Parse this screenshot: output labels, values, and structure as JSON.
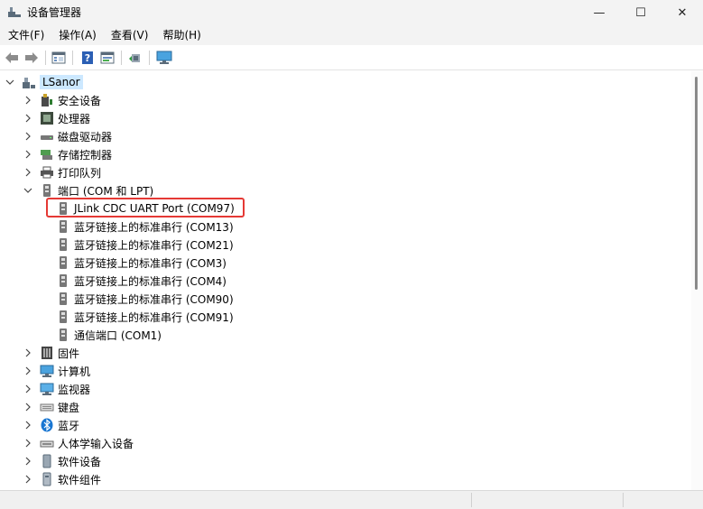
{
  "window": {
    "title": "设备管理器",
    "controls": {
      "minimize": "—",
      "maximize": "☐",
      "close": "✕"
    }
  },
  "menu": [
    {
      "label": "文件(F)"
    },
    {
      "label": "操作(A)"
    },
    {
      "label": "查看(V)"
    },
    {
      "label": "帮助(H)"
    }
  ],
  "toolbar": {
    "buttons": [
      "back-arrow-icon",
      "forward-arrow-icon",
      "properties-icon",
      "help-icon",
      "update-driver-icon",
      "scan-hardware-icon",
      "monitor-icon"
    ]
  },
  "tree": {
    "root": "LSanor",
    "categories": [
      {
        "label": "安全设备",
        "icon": "security-device-icon",
        "expanded": false
      },
      {
        "label": "处理器",
        "icon": "processor-icon",
        "expanded": false
      },
      {
        "label": "磁盘驱动器",
        "icon": "disk-drive-icon",
        "expanded": false
      },
      {
        "label": "存储控制器",
        "icon": "storage-controller-icon",
        "expanded": false
      },
      {
        "label": "打印队列",
        "icon": "printer-icon",
        "expanded": false
      },
      {
        "label": "端口 (COM 和 LPT)",
        "icon": "port-icon",
        "expanded": true,
        "children": [
          {
            "label": "JLink CDC UART Port (COM97)",
            "highlighted": true
          },
          {
            "label": "蓝牙链接上的标准串行 (COM13)"
          },
          {
            "label": "蓝牙链接上的标准串行 (COM21)"
          },
          {
            "label": "蓝牙链接上的标准串行 (COM3)"
          },
          {
            "label": "蓝牙链接上的标准串行 (COM4)"
          },
          {
            "label": "蓝牙链接上的标准串行 (COM90)"
          },
          {
            "label": "蓝牙链接上的标准串行 (COM91)"
          },
          {
            "label": "通信端口 (COM1)"
          }
        ]
      },
      {
        "label": "固件",
        "icon": "firmware-icon",
        "expanded": false
      },
      {
        "label": "计算机",
        "icon": "computer-icon",
        "expanded": false
      },
      {
        "label": "监视器",
        "icon": "monitor-icon",
        "expanded": false
      },
      {
        "label": "键盘",
        "icon": "keyboard-icon",
        "expanded": false
      },
      {
        "label": "蓝牙",
        "icon": "bluetooth-icon",
        "expanded": false
      },
      {
        "label": "人体学输入设备",
        "icon": "hid-icon",
        "expanded": false
      },
      {
        "label": "软件设备",
        "icon": "software-device-icon",
        "expanded": false
      },
      {
        "label": "软件组件",
        "icon": "software-component-icon",
        "expanded": false
      }
    ]
  },
  "colors": {
    "selection": "#cce8ff",
    "highlight_border": "#e53935"
  }
}
